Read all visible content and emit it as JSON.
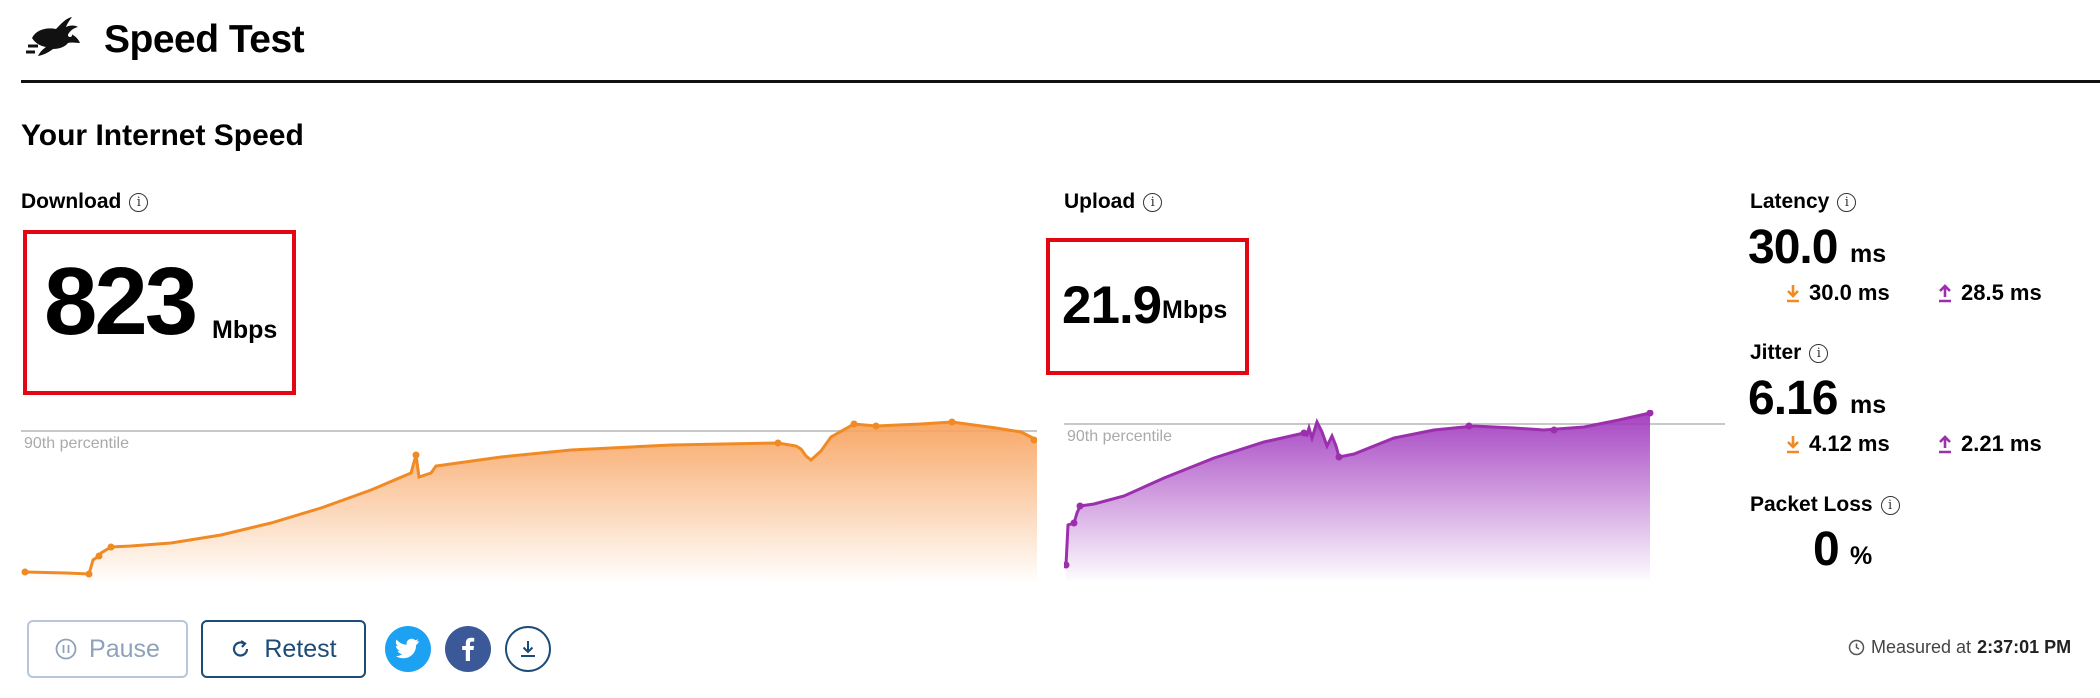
{
  "header": {
    "title": "Speed Test",
    "logo_icon": "running-rabbit-icon"
  },
  "main": {
    "section_title": "Your Internet Speed",
    "download": {
      "label": "Download",
      "value": "823",
      "unit": "Mbps",
      "percentile_label": "90th percentile",
      "chart_color": "#f08a24"
    },
    "upload": {
      "label": "Upload",
      "value": "21.9",
      "unit": "Mbps",
      "percentile_label": "90th percentile",
      "chart_color": "#9b2fae"
    },
    "latency": {
      "label": "Latency",
      "value": "30.0",
      "unit": "ms",
      "down": "30.0 ms",
      "up": "28.5 ms"
    },
    "jitter": {
      "label": "Jitter",
      "value": "6.16",
      "unit": "ms",
      "down": "4.12 ms",
      "up": "2.21 ms"
    },
    "packet_loss": {
      "label": "Packet Loss",
      "value": "0",
      "unit": "%"
    }
  },
  "controls": {
    "pause_label": "Pause",
    "retest_label": "Retest",
    "share_icons": [
      "twitter-icon",
      "facebook-icon",
      "download-icon"
    ]
  },
  "footer": {
    "measured_prefix": "Measured at",
    "measured_time": "2:37:01 PM"
  },
  "colors": {
    "highlight": "#e30613",
    "download_accent": "#f08a24",
    "upload_accent": "#9b2fae",
    "button_primary": "#1d4b78",
    "twitter": "#1da1f2",
    "facebook": "#3b5998"
  }
}
